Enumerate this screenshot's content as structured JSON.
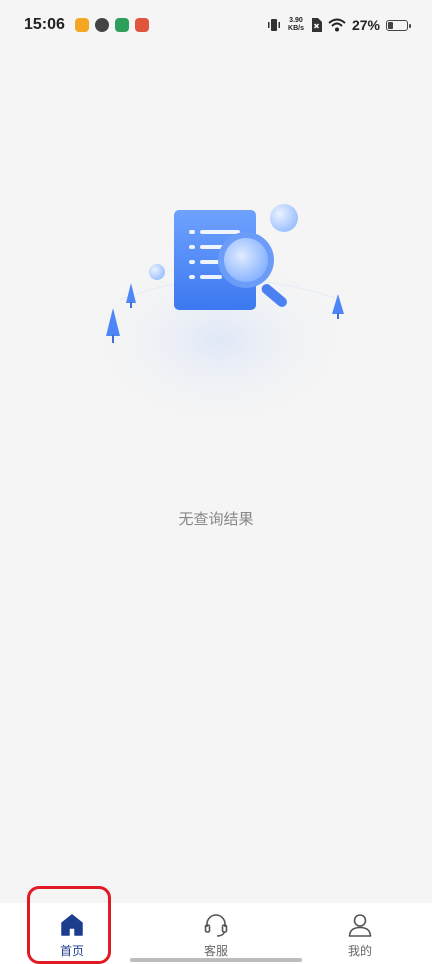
{
  "status_bar": {
    "time": "15:06",
    "network_speed_value": "3.90",
    "network_speed_unit": "KB/s",
    "battery_percent": "27%",
    "battery_level": 0.27
  },
  "main": {
    "empty_message": "无查询结果"
  },
  "tabbar": {
    "items": [
      {
        "label": "首页",
        "icon": "home-icon",
        "active": true
      },
      {
        "label": "客服",
        "icon": "headset-icon",
        "active": false
      },
      {
        "label": "我的",
        "icon": "user-icon",
        "active": false
      }
    ]
  },
  "colors": {
    "accent": "#1d3d8f",
    "highlight": "#e01b24",
    "background": "#f5f5f5",
    "illustration_blue": "#5b8ff9"
  }
}
